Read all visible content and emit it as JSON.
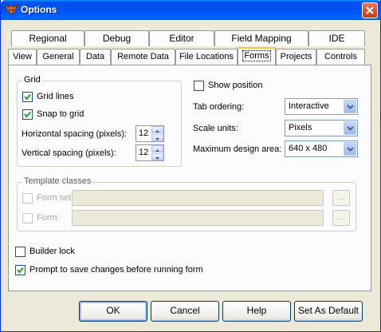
{
  "window": {
    "title": "Options",
    "icon": "fox-app-icon",
    "close_icon": "close-icon"
  },
  "tabs": {
    "row1": [
      {
        "id": "regional",
        "label": "Regional"
      },
      {
        "id": "debug",
        "label": "Debug"
      },
      {
        "id": "editor",
        "label": "Editor"
      },
      {
        "id": "field-mapping",
        "label": "Field Mapping"
      },
      {
        "id": "ide",
        "label": "IDE"
      }
    ],
    "row2": [
      {
        "id": "view",
        "label": "View"
      },
      {
        "id": "general",
        "label": "General"
      },
      {
        "id": "data",
        "label": "Data"
      },
      {
        "id": "remote-data",
        "label": "Remote Data"
      },
      {
        "id": "file-locations",
        "label": "File Locations"
      },
      {
        "id": "forms",
        "label": "Forms",
        "active": true
      },
      {
        "id": "projects",
        "label": "Projects"
      },
      {
        "id": "controls",
        "label": "Controls"
      }
    ]
  },
  "grid": {
    "legend": "Grid",
    "grid_lines": {
      "label": "Grid lines",
      "checked": true
    },
    "snap_to_grid": {
      "label": "Snap to grid",
      "checked": true
    },
    "horizontal_spacing": {
      "label": "Horizontal spacing (pixels):",
      "value": "12"
    },
    "vertical_spacing": {
      "label": "Vertical spacing (pixels):",
      "value": "12"
    }
  },
  "show_position": {
    "label": "Show position",
    "checked": false
  },
  "tab_ordering": {
    "label": "Tab ordering:",
    "value": "Interactive"
  },
  "scale_units": {
    "label": "Scale units:",
    "value": "Pixels"
  },
  "max_design_area": {
    "label": "Maximum design area:",
    "value": "640 x 480"
  },
  "template_classes": {
    "legend": "Template classes",
    "form_set": {
      "label": "Form set:",
      "checked": false,
      "value": "",
      "browse": "..."
    },
    "form": {
      "label": "Form:",
      "checked": false,
      "value": "",
      "browse": "..."
    }
  },
  "builder_lock": {
    "label": "Builder lock",
    "checked": false
  },
  "prompt_to_save": {
    "label": "Prompt to save changes before running form",
    "checked": true
  },
  "buttons": {
    "ok": "OK",
    "cancel": "Cancel",
    "help": "Help",
    "set_as_default": "Set As Default"
  },
  "colors": {
    "titlebar": "#0053ee",
    "face": "#ece9d8",
    "panel": "#fcfcfe",
    "active_tab_accent": "#ffc83c"
  }
}
